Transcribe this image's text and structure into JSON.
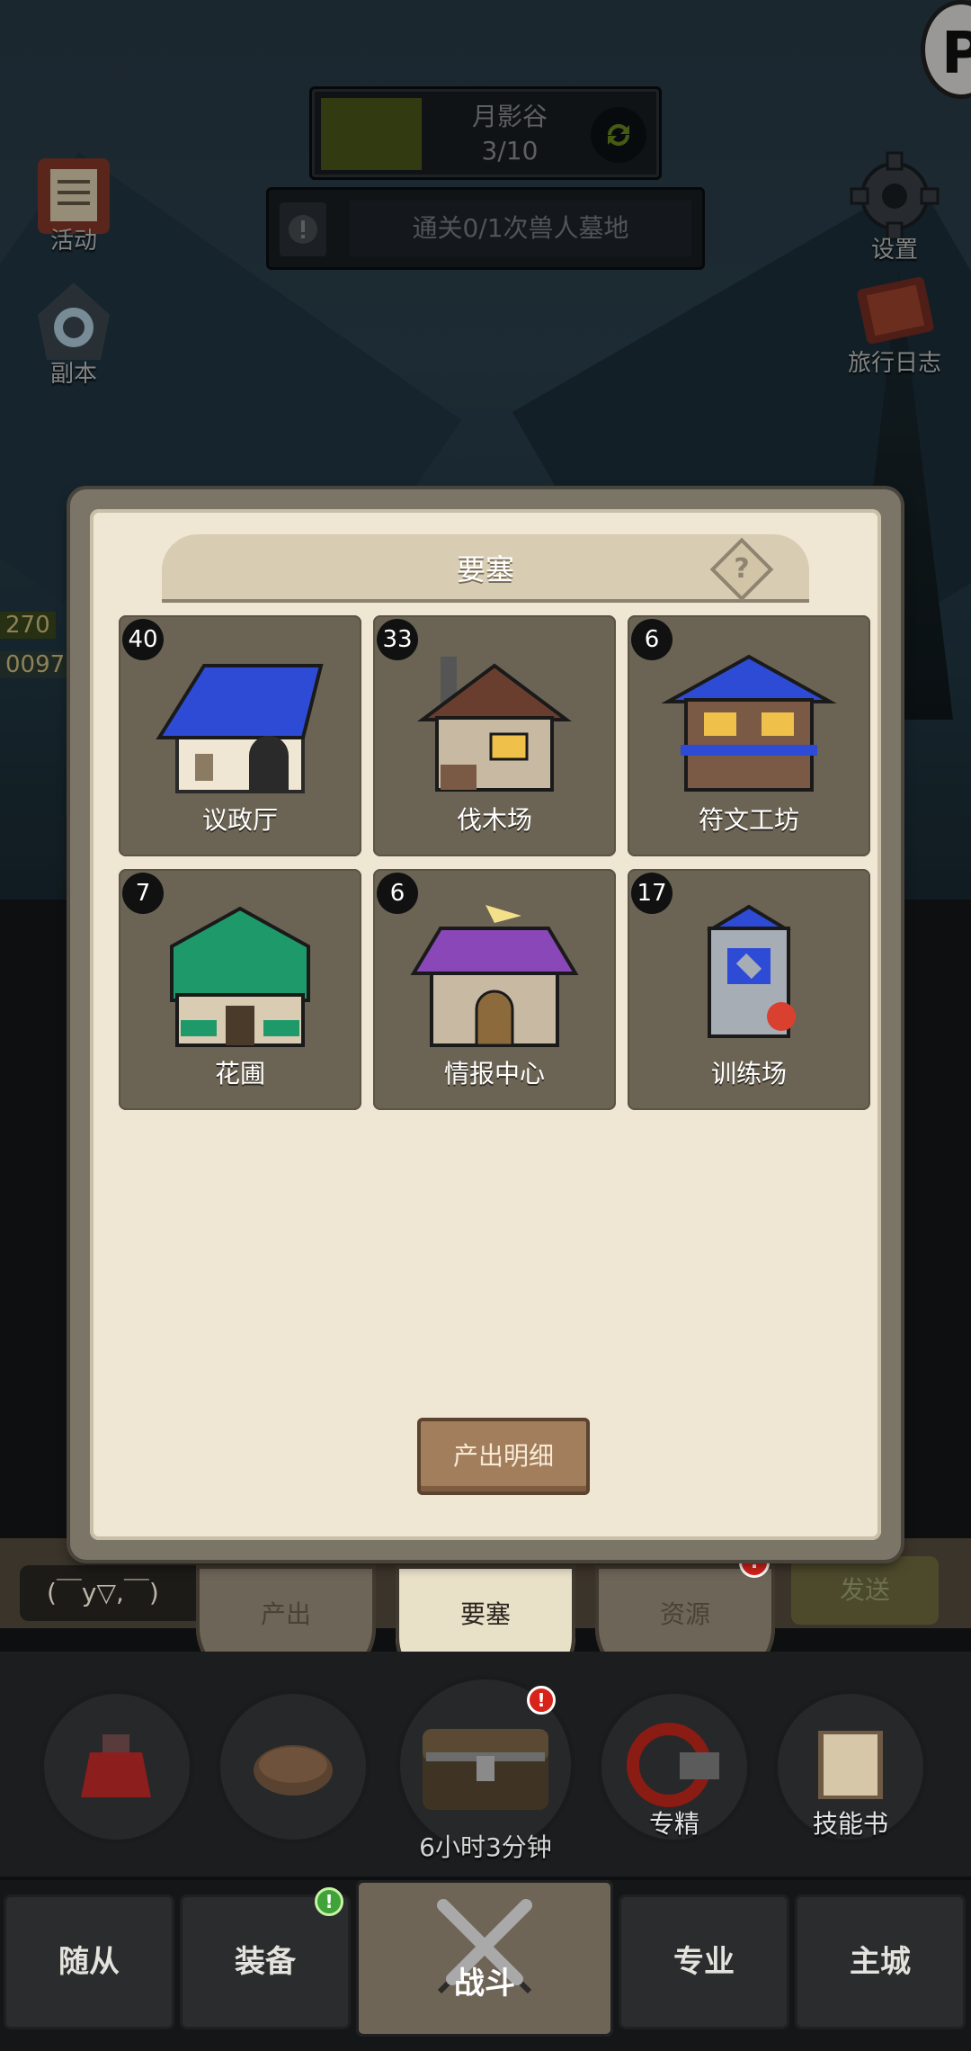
{
  "stage": {
    "name": "月影谷",
    "progress_text": "3/10",
    "progress": 0.3
  },
  "quest": {
    "text": "通关0/1次兽人墓地"
  },
  "left_hud": [
    {
      "label": "活动",
      "icon": "scroll-icon"
    },
    {
      "label": "副本",
      "icon": "portal-icon"
    }
  ],
  "right_hud": [
    {
      "label": "设置",
      "icon": "gear-icon"
    },
    {
      "label": "旅行日志",
      "icon": "journal-icon"
    }
  ],
  "top_right_badge": "P",
  "side_stats": [
    "270",
    "0097"
  ],
  "modal": {
    "title": "要塞",
    "help": "?",
    "buildings": [
      {
        "count": "40",
        "name": "议政厅",
        "icon": "town-hall-icon",
        "roof": "#2e4bd6"
      },
      {
        "count": "33",
        "name": "伐木场",
        "icon": "lumber-mill-icon",
        "roof": "#6a3e2e"
      },
      {
        "count": "6",
        "name": "符文工坊",
        "icon": "rune-workshop-icon",
        "roof": "#2e4bd6"
      },
      {
        "count": "7",
        "name": "花圃",
        "icon": "garden-icon",
        "roof": "#1e9a6a"
      },
      {
        "count": "6",
        "name": "情报中心",
        "icon": "intel-center-icon",
        "roof": "#8a47b8"
      },
      {
        "count": "17",
        "name": "训练场",
        "icon": "training-ground-icon",
        "roof": "#2e4bd6"
      }
    ],
    "detail_button": "产出明细"
  },
  "chat": {
    "input_text": "(￣y▽,￣)",
    "send_label": "发送"
  },
  "tabs": [
    {
      "label": "产出",
      "active": false
    },
    {
      "label": "要塞",
      "active": true
    },
    {
      "label": "资源",
      "active": false,
      "badge": "!"
    }
  ],
  "lower_row": {
    "items": [
      {
        "label": "",
        "icon": "potion-icon"
      },
      {
        "label": "",
        "icon": "bread-icon"
      },
      {
        "label": "",
        "icon": "chest-icon"
      },
      {
        "label": "专精",
        "icon": "mastery-icon"
      },
      {
        "label": "技能书",
        "icon": "skill-book-icon"
      }
    ],
    "chest_timer": "6小时3分钟",
    "chest_badge": "!"
  },
  "nav": [
    {
      "label": "随从"
    },
    {
      "label": "装备",
      "badge": "!"
    },
    {
      "label": "战斗",
      "active": true
    },
    {
      "label": "专业"
    },
    {
      "label": "主城"
    }
  ]
}
